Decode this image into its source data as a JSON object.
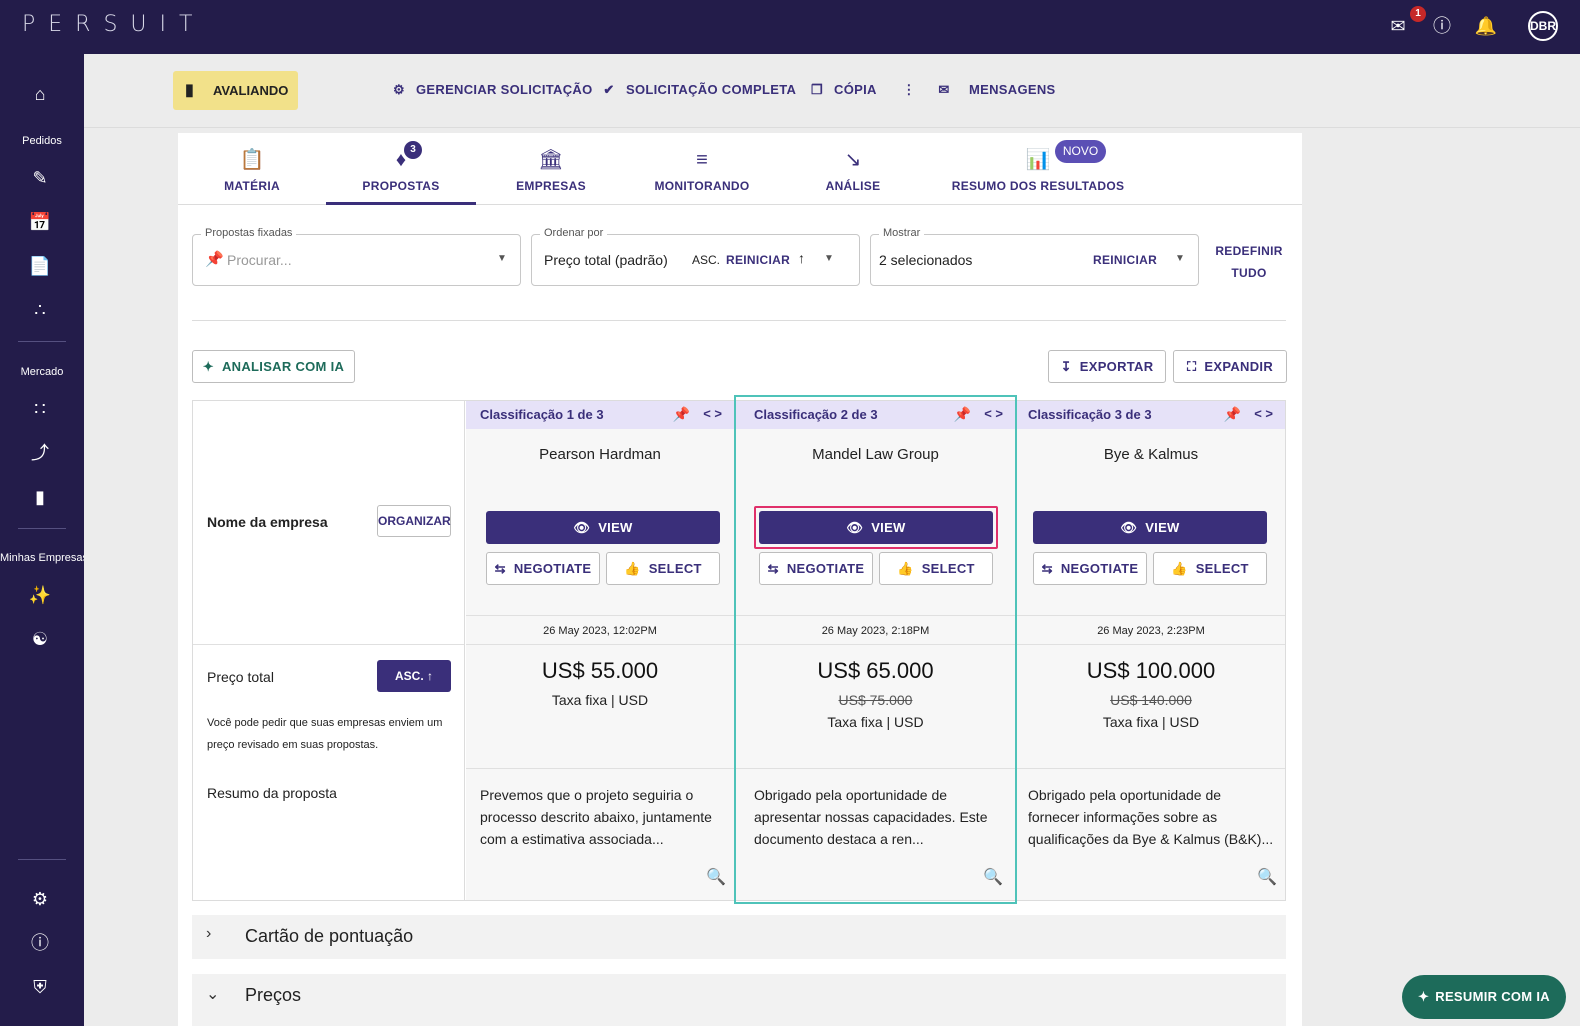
{
  "topbar": {
    "logo": "PERSUIT",
    "notification_count": "1",
    "avatar_initials": "DBR"
  },
  "sidebar": {
    "section_pedidos": "Pedidos",
    "section_mercado": "Mercado",
    "section_minhas_empresas": "Minhas Empresas"
  },
  "actionbar": {
    "status": "AVALIANDO",
    "manage": "GERENCIAR SOLICITAÇÃO",
    "complete": "SOLICITAÇÃO COMPLETA",
    "copy": "CÓPIA",
    "messages": "MENSAGENS"
  },
  "tabs": [
    {
      "label": "MATÉRIA"
    },
    {
      "label": "PROPOSTAS",
      "badge": "3"
    },
    {
      "label": "EMPRESAS"
    },
    {
      "label": "MONITORANDO"
    },
    {
      "label": "ANÁLISE"
    },
    {
      "label": "RESUMO DOS RESULTADOS",
      "badge": "NOVO"
    }
  ],
  "filters": {
    "pinned_label": "Propostas fixadas",
    "pinned_placeholder": "Procurar...",
    "order_label": "Ordenar por",
    "order_value": "Preço total (padrão)",
    "order_dir": "ASC.",
    "order_reset": "REINICIAR",
    "show_label": "Mostrar",
    "show_value": "2 selecionados",
    "show_reset": "REINICIAR",
    "reset_all_1": "REDEFINIR",
    "reset_all_2": "TUDO"
  },
  "toolbar": {
    "analyze": "ANALISAR COM IA",
    "export": "EXPORTAR",
    "expand": "EXPANDIR"
  },
  "rows": {
    "firm_name": "Nome da empresa",
    "organize": "ORGANIZAR",
    "total_price": "Preço total",
    "sort_btn": "ASC.",
    "price_hint": "Você pode pedir que suas empresas enviem um preço revisado em suas propostas.",
    "summary": "Resumo da proposta"
  },
  "proposals": [
    {
      "rank": "Classificação 1 de 3",
      "firm": "Pearson Hardman",
      "view": "VIEW",
      "negotiate": "NEGOTIATE",
      "select": "SELECT",
      "date": "26 May 2023, 12:02PM",
      "price": "US$ 55.000",
      "old_price": "",
      "fee": "Taxa fixa | USD",
      "summary": "Prevemos que o projeto seguiria o processo descrito abaixo, juntamente com a estimativa associada..."
    },
    {
      "rank": "Classificação 2 de 3",
      "firm": "Mandel Law Group",
      "view": "VIEW",
      "negotiate": "NEGOTIATE",
      "select": "SELECT",
      "date": "26 May 2023, 2:18PM",
      "price": "US$ 65.000",
      "old_price": "US$ 75.000",
      "fee": "Taxa fixa | USD",
      "summary": "Obrigado pela oportunidade de apresentar nossas capacidades. Este documento destaca a ren..."
    },
    {
      "rank": "Classificação 3 de 3",
      "firm": "Bye & Kalmus",
      "view": "VIEW",
      "negotiate": "NEGOTIATE",
      "select": "SELECT",
      "date": "26 May 2023, 2:23PM",
      "price": "US$ 100.000",
      "old_price": "US$ 140.000",
      "fee": "Taxa fixa | USD",
      "summary": "Obrigado pela oportunidade de fornecer informações sobre as qualificações da Bye & Kalmus (B&K)..."
    }
  ],
  "sections": {
    "scorecard": "Cartão de pontuação",
    "prices": "Preços"
  },
  "fab": "RESUMIR COM IA",
  "colors": {
    "brand": "#231c4a",
    "accent": "#3a2f7a",
    "status": "#f2e18a",
    "fab": "#1d6b5a"
  }
}
